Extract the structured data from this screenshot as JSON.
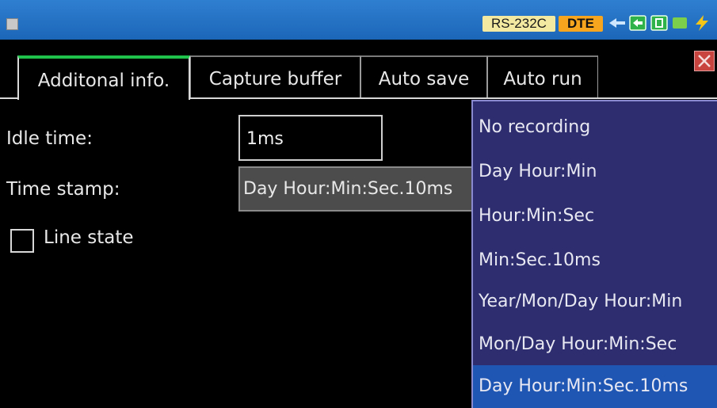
{
  "titlebar": {
    "port_badge": "RS-232C",
    "mode_badge": "DTE",
    "icons": [
      "menu-icon",
      "plug-icon",
      "link-icon",
      "card-icon",
      "charge-icon",
      "bolt-icon"
    ]
  },
  "tabs": [
    {
      "label": "Additonal info.",
      "active": true
    },
    {
      "label": "Capture buffer",
      "active": false
    },
    {
      "label": "Auto save",
      "active": false
    },
    {
      "label": "Auto run",
      "active": false
    }
  ],
  "form": {
    "idle_label": "Idle time:",
    "idle_value": "1ms",
    "stamp_label": "Time stamp:",
    "stamp_value": "Day Hour:Min:Sec.10ms",
    "line_state_label": "Line state",
    "line_state_checked": false
  },
  "dropdown": {
    "options": [
      "No recording",
      "Day Hour:Min",
      "Hour:Min:Sec",
      "Min:Sec.10ms",
      "Year/Mon/Day Hour:Min",
      "Mon/Day Hour:Min:Sec",
      "Day Hour:Min:Sec.10ms"
    ],
    "selected_index": 6
  },
  "colors": {
    "titlebar": "#1c66b8",
    "active_tab_accent": "#1fc24a",
    "dropdown_bg": "#2d2d6f",
    "dropdown_selected": "#1f56b4",
    "close_button": "#c8453f",
    "mode_badge": "#f7a51e",
    "port_badge": "#f3e9a0"
  }
}
